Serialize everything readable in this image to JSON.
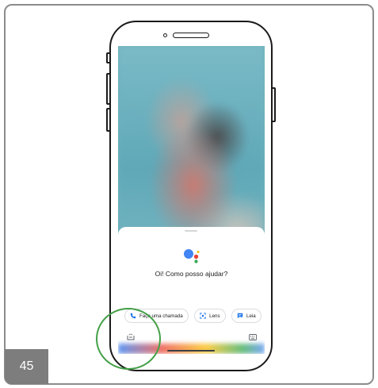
{
  "assistant": {
    "greeting": "Oi! Como posso ajudar?",
    "logo_icon": "google-assistant-icon",
    "suggestions": [
      {
        "label": "Faça uma chamada",
        "icon": "phone-icon",
        "icon_color": "#1a73e8"
      },
      {
        "label": "Lens",
        "icon": "lens-icon",
        "icon_color": "#1a73e8"
      },
      {
        "label": "Leia",
        "icon": "message-icon",
        "icon_color": "#1a73e8"
      }
    ],
    "left_icon": "snapshot-icon",
    "right_icon": "keyboard-icon"
  },
  "highlight": {
    "color": "#43a047",
    "target": "snapshot-icon"
  },
  "page": {
    "number": "45"
  },
  "colors": {
    "google_blue": "#4285f4",
    "google_red": "#ea4335",
    "google_yellow": "#fbbc05",
    "google_green": "#34a853"
  }
}
